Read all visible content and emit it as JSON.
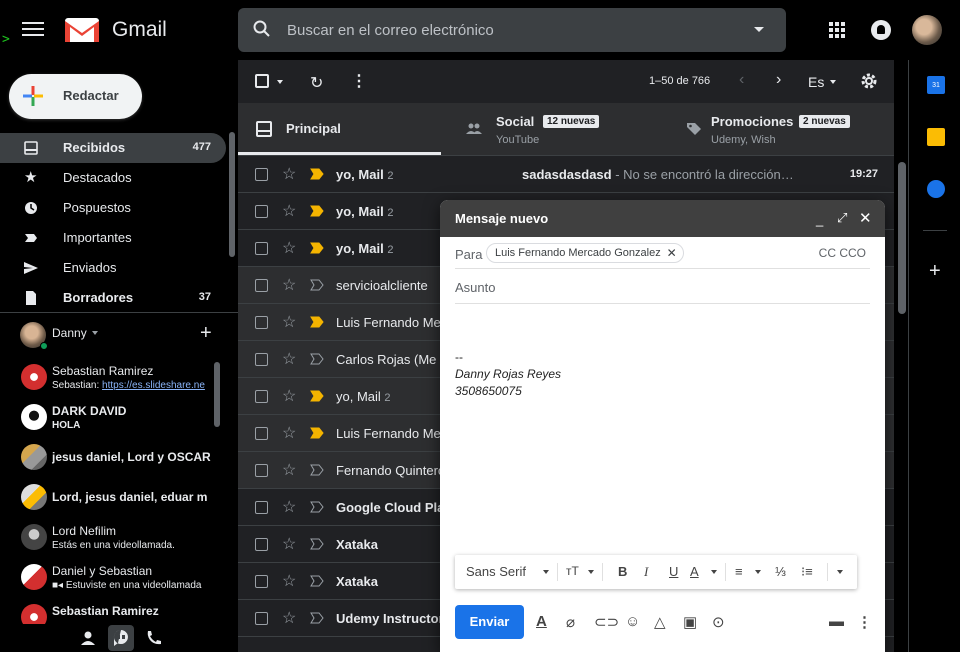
{
  "topbar": {
    "app_name": "Gmail",
    "search_placeholder": "Buscar en el correo electrónico",
    "terminal_glyph": ">"
  },
  "sidebar": {
    "compose_label": "Redactar",
    "items": [
      {
        "label": "Recibidos",
        "count": "477",
        "icon": "inbox-icon",
        "active": true,
        "bold": true
      },
      {
        "label": "Destacados",
        "count": "",
        "icon": "star-icon"
      },
      {
        "label": "Pospuestos",
        "count": "",
        "icon": "clock-icon"
      },
      {
        "label": "Importantes",
        "count": "",
        "icon": "important-icon"
      },
      {
        "label": "Enviados",
        "count": "",
        "icon": "send-icon"
      },
      {
        "label": "Borradores",
        "count": "37",
        "icon": "draft-icon",
        "bold": true
      }
    ]
  },
  "hangouts": {
    "me_name": "Danny",
    "contacts": [
      {
        "name": "Sebastian Ramirez",
        "sub": "Sebastian: ",
        "link": "https://es.slideshare.ne"
      },
      {
        "name": "DARK DAVID",
        "sub": "HOLA",
        "bold": true
      },
      {
        "name": "jesus daniel, Lord y OSCAR",
        "sub": "",
        "bold": true
      },
      {
        "name": "Lord, jesus daniel, eduar m",
        "sub": "",
        "bold": true
      },
      {
        "name": "Lord Nefilim",
        "sub": "Estás en una videollamada."
      },
      {
        "name": "Daniel y Sebastian",
        "sub": "Estuviste en una videollamada"
      },
      {
        "name": "Sebastian Ramirez",
        "sub": "",
        "bold": true
      }
    ]
  },
  "toolbar": {
    "range": "1–50 de 766",
    "lang": "Es"
  },
  "tabs": [
    {
      "label": "Principal",
      "icon": "inbox-tab-icon"
    },
    {
      "label": "Social",
      "badge": "12 nuevas",
      "sub": "YouTube",
      "icon": "people-icon"
    },
    {
      "label": "Promociones",
      "badge": "2 nuevas",
      "sub": "Udemy, Wish",
      "icon": "tag-icon"
    }
  ],
  "emails": [
    {
      "sender": "yo, Mail",
      "count": "2",
      "subject": "sadasdasdasd",
      "snippet": " - No se encontró la dirección…",
      "time": "19:27",
      "unread": true,
      "important": true
    },
    {
      "sender": "yo, Mail",
      "count": "2",
      "subject": "",
      "snippet": "",
      "time": "",
      "unread": true,
      "important": true
    },
    {
      "sender": "yo, Mail",
      "count": "2",
      "subject": "",
      "snippet": "",
      "time": "",
      "unread": true,
      "important": true
    },
    {
      "sender": "servicioalcliente",
      "count": "",
      "subject": "",
      "snippet": "",
      "time": "",
      "unread": false,
      "important": false
    },
    {
      "sender": "Luis Fernando Me",
      "count": "",
      "subject": "",
      "snippet": "",
      "time": "",
      "unread": false,
      "important": true
    },
    {
      "sender": "Carlos Rojas (Me",
      "count": "",
      "subject": "",
      "snippet": "",
      "time": "",
      "unread": false,
      "important": false
    },
    {
      "sender": "yo, Mail",
      "count": "2",
      "subject": "",
      "snippet": "",
      "time": "",
      "unread": false,
      "important": true
    },
    {
      "sender": "Luis Fernando Me",
      "count": "",
      "subject": "",
      "snippet": "",
      "time": "",
      "unread": false,
      "important": true
    },
    {
      "sender": "Fernando Quintero",
      "count": "",
      "subject": "",
      "snippet": "",
      "time": "",
      "unread": false,
      "important": false
    },
    {
      "sender": "Google Cloud Pla",
      "count": "",
      "subject": "",
      "snippet": "",
      "time": "",
      "unread": true,
      "important": false
    },
    {
      "sender": "Xataka",
      "count": "",
      "subject": "",
      "snippet": "",
      "time": "",
      "unread": true,
      "important": false
    },
    {
      "sender": "Xataka",
      "count": "",
      "subject": "",
      "snippet": "",
      "time": "",
      "unread": true,
      "important": false
    },
    {
      "sender": "Udemy Instructor",
      "count": "",
      "subject": "",
      "snippet": "",
      "time": "",
      "unread": true,
      "important": false
    }
  ],
  "compose": {
    "title": "Mensaje nuevo",
    "to_label": "Para",
    "recipient": "Luis Fernando Mercado Gonzalez",
    "cc_label": "CC CCO",
    "subject_placeholder": "Asunto",
    "sig_dash": "--",
    "sig_name": "Danny Rojas Reyes",
    "sig_phone": "3508650075",
    "font_name": "Sans Serif",
    "send_label": "Enviar"
  },
  "rail": {
    "calendar_day": "31"
  },
  "colors": {
    "accent": "#1a73e8",
    "important": "#f4b400",
    "online": "#0f9d58"
  }
}
